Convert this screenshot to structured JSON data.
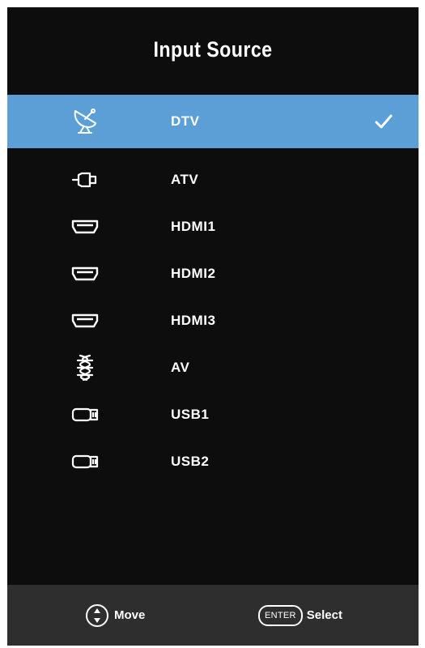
{
  "title": "Input Source",
  "colors": {
    "panel_background": "#0d0d0d",
    "highlight": "#5b9fd6",
    "footer_background": "#2e2e2e",
    "text": "#ffffff"
  },
  "sources": [
    {
      "label": "DTV",
      "icon": "satellite-dish-icon",
      "selected": true,
      "checked": true
    },
    {
      "label": "ATV",
      "icon": "antenna-plug-icon",
      "selected": false,
      "checked": false
    },
    {
      "label": "HDMI1",
      "icon": "hdmi-port-icon",
      "selected": false,
      "checked": false
    },
    {
      "label": "HDMI2",
      "icon": "hdmi-port-icon",
      "selected": false,
      "checked": false
    },
    {
      "label": "HDMI3",
      "icon": "hdmi-port-icon",
      "selected": false,
      "checked": false
    },
    {
      "label": "AV",
      "icon": "av-cable-icon",
      "selected": false,
      "checked": false
    },
    {
      "label": "USB1",
      "icon": "usb-icon",
      "selected": false,
      "checked": false
    },
    {
      "label": "USB2",
      "icon": "usb-icon",
      "selected": false,
      "checked": false
    }
  ],
  "footer": {
    "move_label": "Move",
    "move_icon": "up-down-arrows-icon",
    "enter_key": "ENTER",
    "select_label": "Select"
  }
}
